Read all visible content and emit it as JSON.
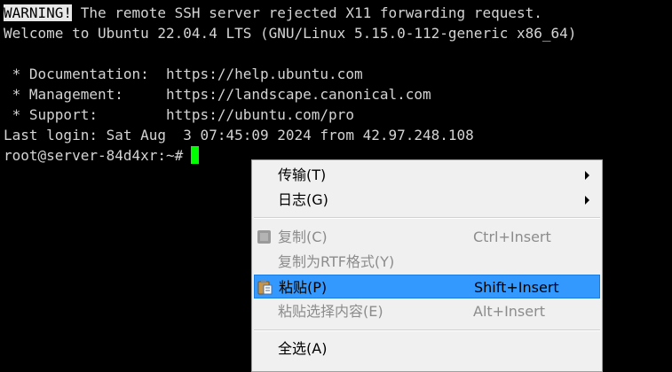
{
  "terminal": {
    "warning_tag": "WARNING!",
    "warning_text": " The remote SSH server rejected X11 forwarding request.",
    "welcome": "Welcome to Ubuntu 22.04.4 LTS (GNU/Linux 5.15.0-112-generic x86_64)",
    "doc_line": " * Documentation:  https://help.ubuntu.com",
    "mgmt_line": " * Management:     https://landscape.canonical.com",
    "support_line": " * Support:        https://ubuntu.com/pro",
    "last_login": "Last login: Sat Aug  3 07:45:09 2024 from 42.97.248.108",
    "prompt": "root@server-84d4xr:~#",
    "cursor_color": "#00ff00"
  },
  "context_menu": {
    "transfer": "传输(T)",
    "log": "日志(G)",
    "copy": "复制(C)",
    "copy_shortcut": "Ctrl+Insert",
    "copy_rtf": "复制为RTF格式(Y)",
    "paste": "粘贴(P)",
    "paste_shortcut": "Shift+Insert",
    "paste_selection": "粘贴选择内容(E)",
    "paste_selection_shortcut": "Alt+Insert",
    "select_all": "全选(A)",
    "highlight_color": "#3399ff"
  }
}
